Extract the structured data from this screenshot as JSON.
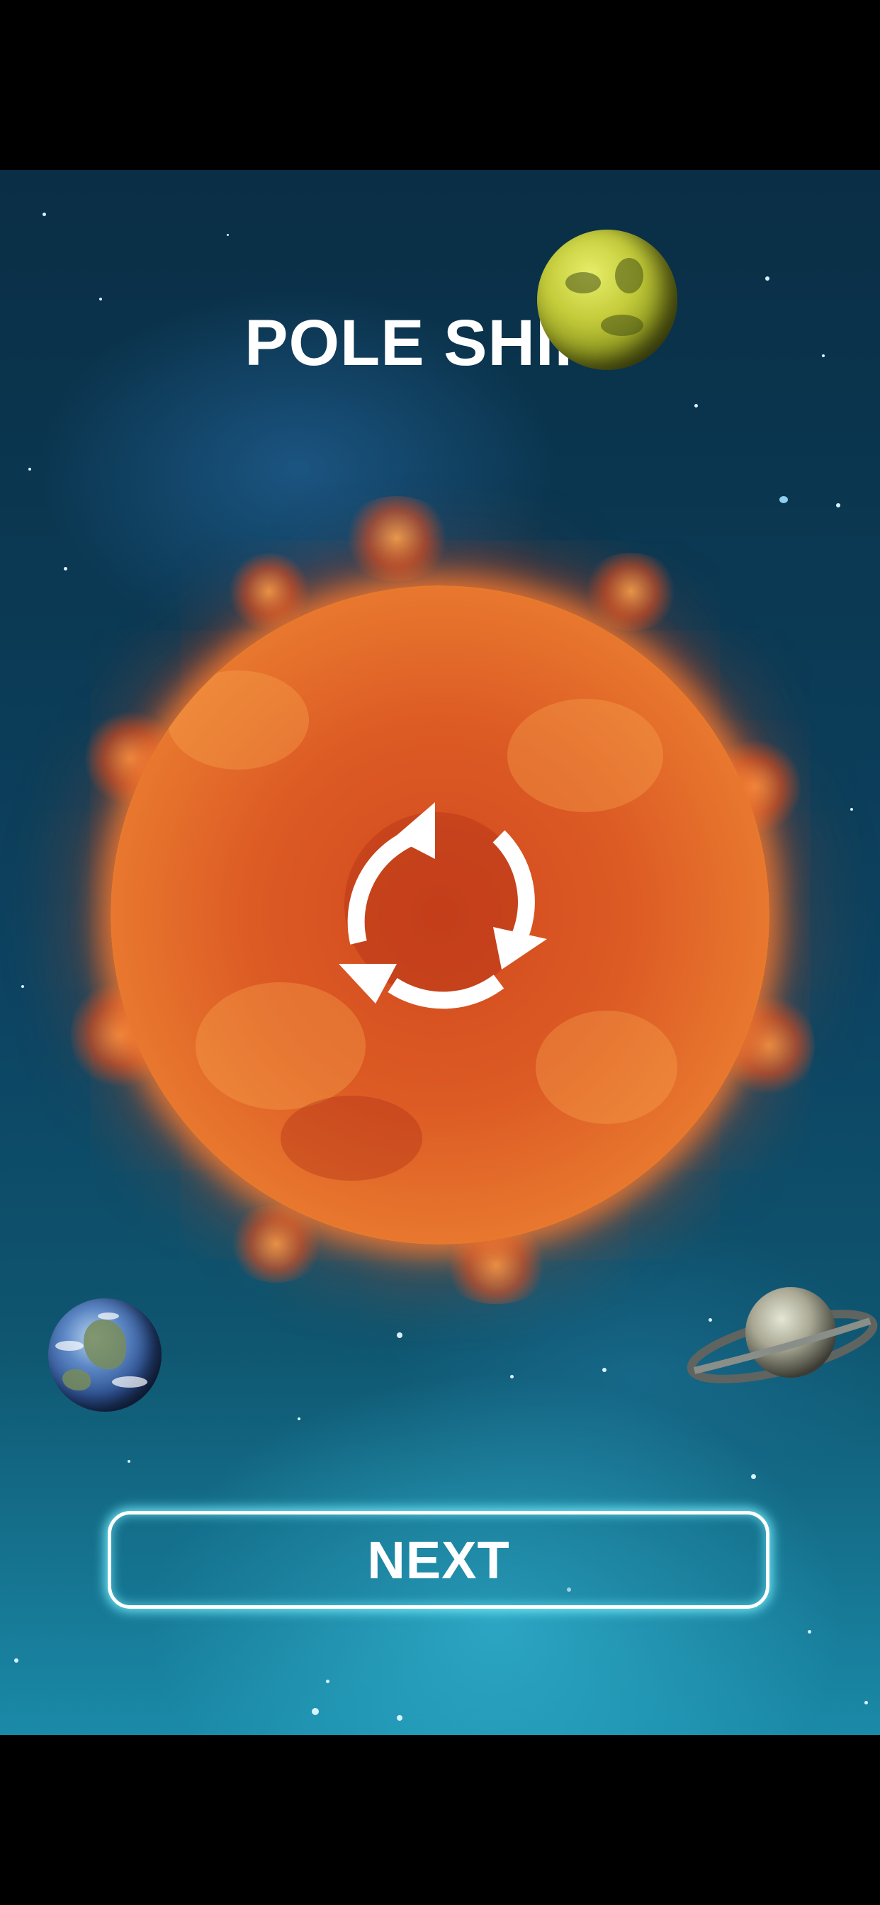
{
  "screen": {
    "title": "POLE SHIFT",
    "next_button_label": "NEXT"
  },
  "icons": {
    "center_icon": "restart-cycle-icon",
    "planets": [
      "yellow-planet",
      "sun",
      "earth",
      "saturn"
    ]
  },
  "colors": {
    "title_text": "#ffffff",
    "button_border": "#ffffff",
    "button_glow": "#78f0ff",
    "sun_core": "#d24a1e",
    "sun_rim": "#f9c46a",
    "space_top": "#0a2e45",
    "space_bottom": "#1a8aa8"
  }
}
